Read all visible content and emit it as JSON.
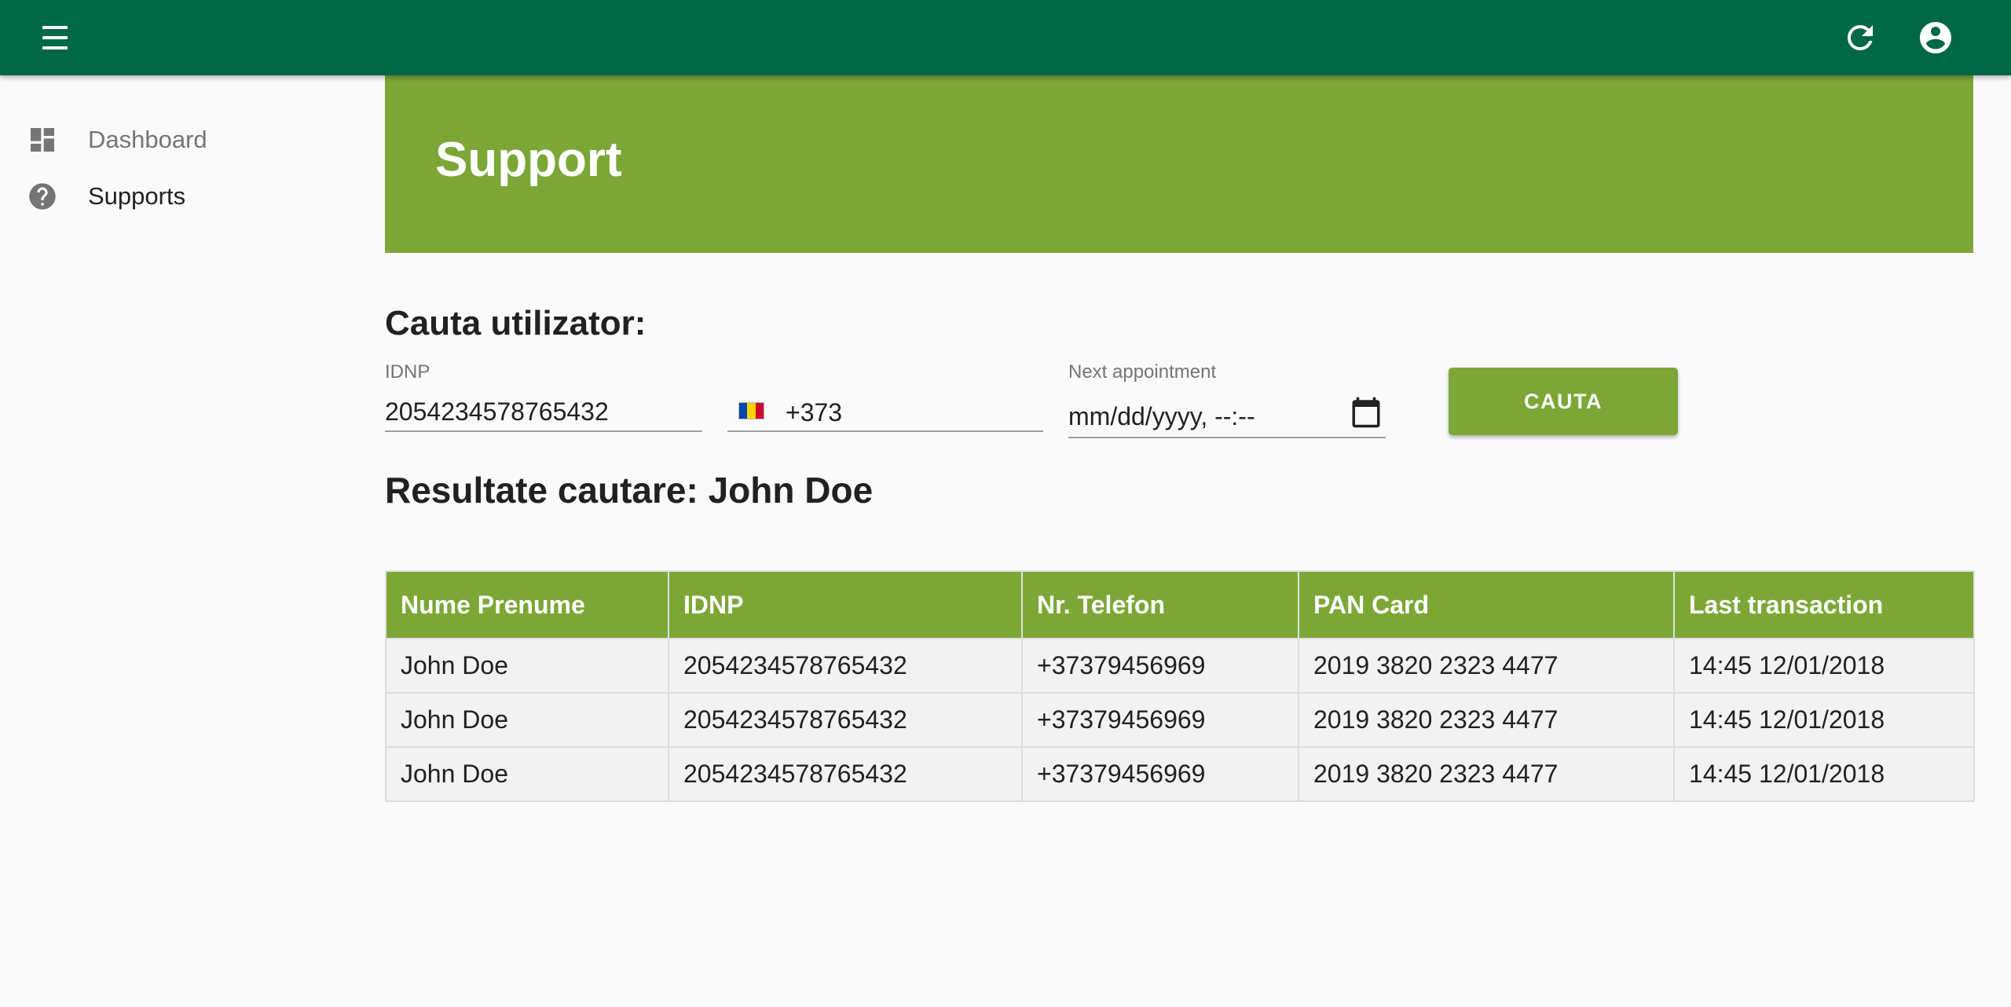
{
  "header": {
    "menu_icon": "menu-icon",
    "refresh_icon": "refresh-icon",
    "account_icon": "account-circle-icon",
    "color": "#006845"
  },
  "sidebar": {
    "items": [
      {
        "label": "Dashboard",
        "icon": "dashboard-icon"
      },
      {
        "label": "Supports",
        "icon": "help-circle-icon"
      }
    ]
  },
  "banner": {
    "title": "Support",
    "color": "#7ca736"
  },
  "search": {
    "title": "Cauta utilizator:",
    "idnp_label": "IDNP",
    "idnp_value": "2054234578765432",
    "phone_flag_icon": "moldova-flag-icon",
    "phone_prefix": "+373",
    "appointment_label": "Next appointment",
    "appointment_placeholder": "mm/dd/yyyy, --:--",
    "calendar_icon": "calendar-icon",
    "button_label": "CAUTA"
  },
  "results": {
    "title": "Resultate cautare: John Doe",
    "columns": [
      "Nume Prenume",
      "IDNP",
      "Nr. Telefon",
      "PAN Card",
      "Last transaction"
    ],
    "rows": [
      [
        "John Doe",
        "2054234578765432",
        "+37379456969",
        "2019 3820 2323 4477",
        "14:45 12/01/2018"
      ],
      [
        "John Doe",
        "2054234578765432",
        "+37379456969",
        "2019 3820 2323 4477",
        "14:45 12/01/2018"
      ],
      [
        "John Doe",
        "2054234578765432",
        "+37379456969",
        "2019 3820 2323 4477",
        "14:45 12/01/2018"
      ]
    ]
  }
}
